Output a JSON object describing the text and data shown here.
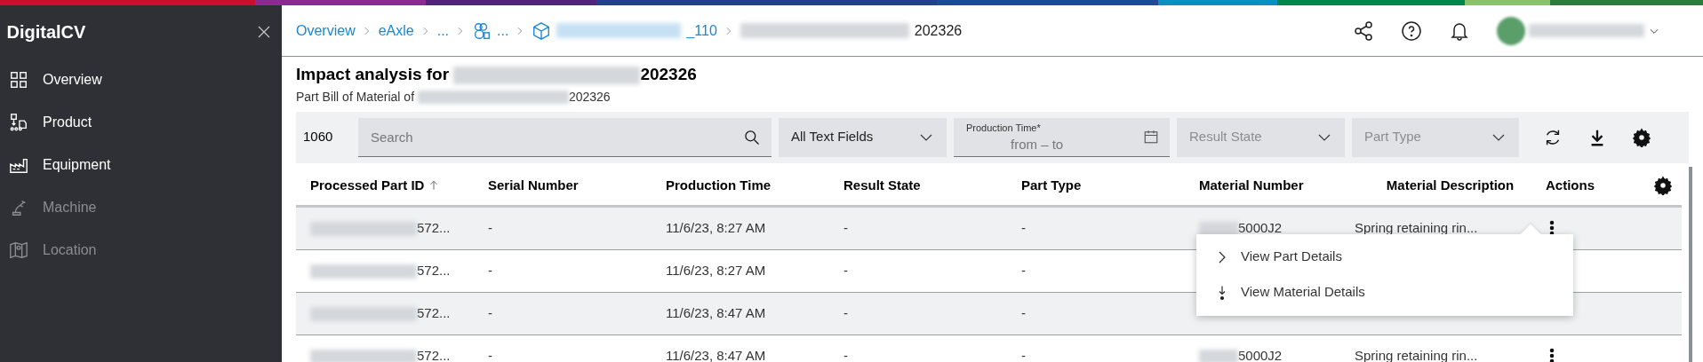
{
  "sidebar": {
    "title": "DigitalCV",
    "items": [
      {
        "label": "Overview",
        "disabled": false
      },
      {
        "label": "Product",
        "disabled": false
      },
      {
        "label": "Equipment",
        "disabled": false
      },
      {
        "label": "Machine",
        "disabled": true
      },
      {
        "label": "Location",
        "disabled": true
      }
    ]
  },
  "breadcrumb": [
    {
      "label": "Overview",
      "kind": "link",
      "redacted": false
    },
    {
      "label": "eAxle",
      "kind": "link",
      "redacted": false
    },
    {
      "label": "...",
      "kind": "link",
      "redacted": false
    },
    {
      "label": "...",
      "kind": "group",
      "redacted": false
    },
    {
      "label": "_110",
      "kind": "material",
      "redacted": true
    },
    {
      "label": "202326",
      "kind": "current",
      "redacted": true
    }
  ],
  "page": {
    "title_prefix": "Impact analysis for",
    "title_suffix": "202326",
    "subtitle_prefix": "Part Bill of Material of",
    "subtitle_suffix": "202326"
  },
  "filters": {
    "count": "1060",
    "search": {
      "placeholder": "Search"
    },
    "text_fields": {
      "value": "All Text Fields"
    },
    "production_time": {
      "label": "Production Time*",
      "placeholder": "from – to"
    },
    "result_state": {
      "placeholder": "Result State"
    },
    "part_type": {
      "placeholder": "Part Type"
    }
  },
  "table": {
    "columns": [
      {
        "label": "Processed Part ID",
        "sorted": true
      },
      {
        "label": "Serial Number",
        "sorted": false
      },
      {
        "label": "Production Time",
        "sorted": false
      },
      {
        "label": "Result State",
        "sorted": false
      },
      {
        "label": "Part Type",
        "sorted": false
      },
      {
        "label": "Material Number",
        "sorted": false
      },
      {
        "label": "Material Description",
        "sorted": false
      },
      {
        "label": "Actions",
        "sorted": false
      }
    ],
    "rows": [
      {
        "part_id": "572...",
        "serial": "-",
        "time": "11/6/23, 8:27 AM",
        "result": "-",
        "part_type": "-",
        "material_number": "5000J2",
        "description": "Spring retaining rin...",
        "actions": true
      },
      {
        "part_id": "572...",
        "serial": "-",
        "time": "11/6/23, 8:27 AM",
        "result": "-",
        "part_type": "-",
        "actions": false
      },
      {
        "part_id": "572...",
        "serial": "-",
        "time": "11/6/23, 8:47 AM",
        "result": "-",
        "part_type": "-",
        "actions": false
      },
      {
        "part_id": "572...",
        "serial": "-",
        "time": "11/6/23, 8:47 AM",
        "result": "-",
        "part_type": "-",
        "material_number": "5000J2",
        "description": "Spring retaining rin...",
        "actions": true
      }
    ]
  },
  "action_menu": {
    "items": [
      {
        "label": "View Part Details"
      },
      {
        "label": "View Material Details"
      }
    ]
  }
}
